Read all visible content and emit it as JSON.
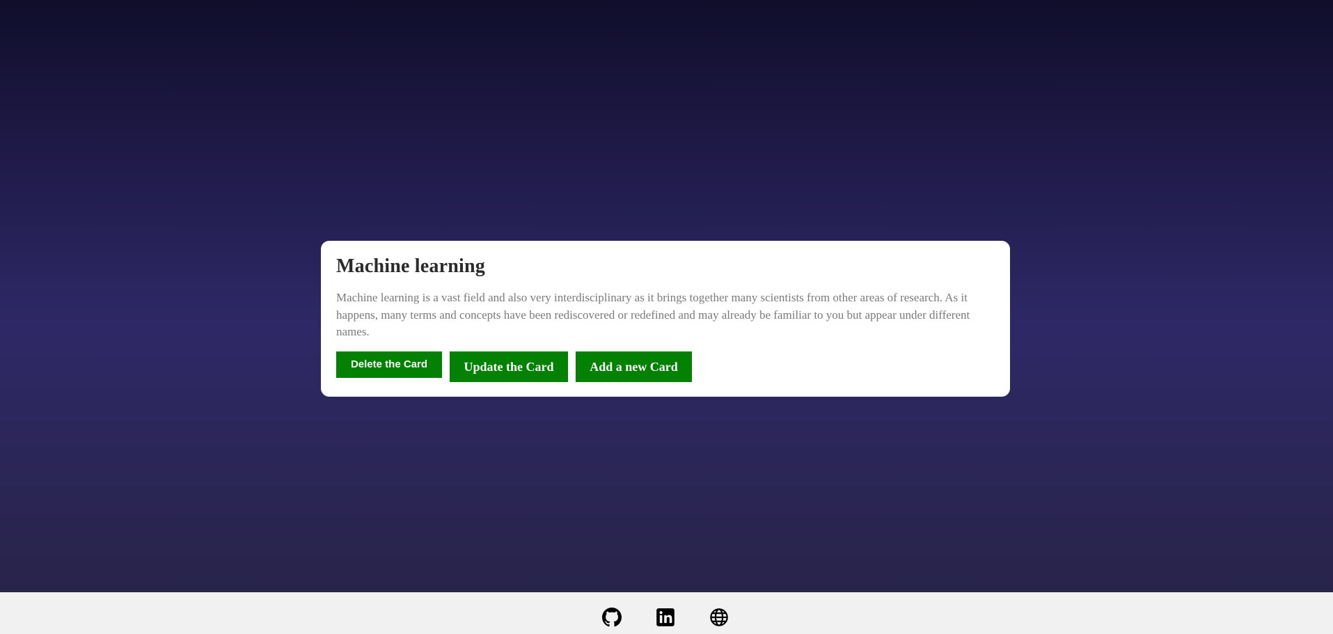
{
  "card": {
    "title": "Machine learning",
    "description": "Machine learning is a vast field and also very interdisciplinary as it brings together many scientists from other areas of research. As it happens, many terms and concepts have been rediscovered or redefined and may already be familiar to you but appear under different names.",
    "buttons": {
      "delete_label": "Delete the Card",
      "update_label": "Update the Card",
      "add_label": "Add a new Card"
    }
  },
  "footer": {
    "links": [
      {
        "icon": "github-icon"
      },
      {
        "icon": "linkedin-icon"
      },
      {
        "icon": "globe-icon"
      }
    ]
  },
  "colors": {
    "button_bg": "#028102",
    "button_text": "#ffffff",
    "card_bg": "#ffffff",
    "title_text": "#2b2b2b",
    "body_text": "#7a7a7a",
    "footer_bg": "#f1f1f1",
    "background_top": "#100e2b",
    "background_mid": "#2e2966",
    "background_bottom": "#27244a"
  }
}
